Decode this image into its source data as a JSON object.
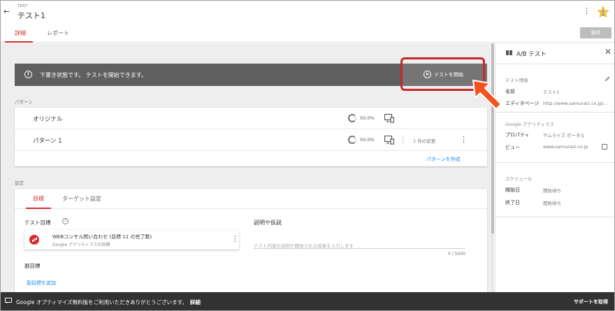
{
  "header": {
    "back_icon": "←",
    "crumb": "TEST",
    "title": "テスト1",
    "more_icon": "⋮"
  },
  "tabs": [
    {
      "label": "詳細",
      "active": true
    },
    {
      "label": "レポート",
      "active": false
    }
  ],
  "toolbar": {
    "save_label": "保存"
  },
  "banner": {
    "icon": "!",
    "text": "下書き状態です。 テストを開始できます。",
    "start_label": "テストを開始"
  },
  "patterns": {
    "section_label": "パターン",
    "rows": [
      {
        "name": "オリジナル",
        "weight": "50.0%",
        "changes": ""
      },
      {
        "name": "パターン 1",
        "weight": "50.0%",
        "changes": "1 件の変更"
      }
    ],
    "create_link": "パターンを作成"
  },
  "settings": {
    "section_label": "設定",
    "subtabs": [
      {
        "label": "目標",
        "active": true
      },
      {
        "label": "ターゲット設定",
        "active": false
      }
    ],
    "goal_label": "テスト目標",
    "goal_help_icon": "?",
    "goal": {
      "title": "WEBコンサル問い合わせ (目標 11 の完了数)",
      "subtitle": "Google アナリティクスの目標"
    },
    "description_label": "説明や仮説",
    "description_placeholder": "テスト内容の説明や期待される成果を入力します",
    "description_count": "0 / 5000",
    "secondary_label": "副目標",
    "add_secondary_link": "副目標を追加"
  },
  "panel": {
    "title": "A/B テスト",
    "close_icon": "✕",
    "test_info": {
      "label": "テスト情報",
      "name_key": "名前",
      "name_value": "テスト1",
      "editor_key": "エディタページ",
      "editor_value": "http://www.samuraiz.co.jp/..."
    },
    "analytics": {
      "label": "Google アナリティクス",
      "property_key": "プロパティ",
      "property_value": "サムライズ ポータル",
      "view_key": "ビュー",
      "view_value": "www.samuraiz.co.jp"
    },
    "schedule": {
      "label": "スケジュール",
      "start_key": "開始日",
      "start_value": "開始待ち",
      "end_key": "終了日",
      "end_value": "開始待ち"
    }
  },
  "footer": {
    "text": "Google オプティマイズ無料版をご利用いただきありがとうございます。",
    "link": "詳細",
    "support": "サポートを取得"
  },
  "colors": {
    "accent": "#d32f2f",
    "link": "#1e88e5",
    "banner": "#5f5f5f",
    "highlight": "#c62828",
    "arrow": "#f4511e"
  }
}
